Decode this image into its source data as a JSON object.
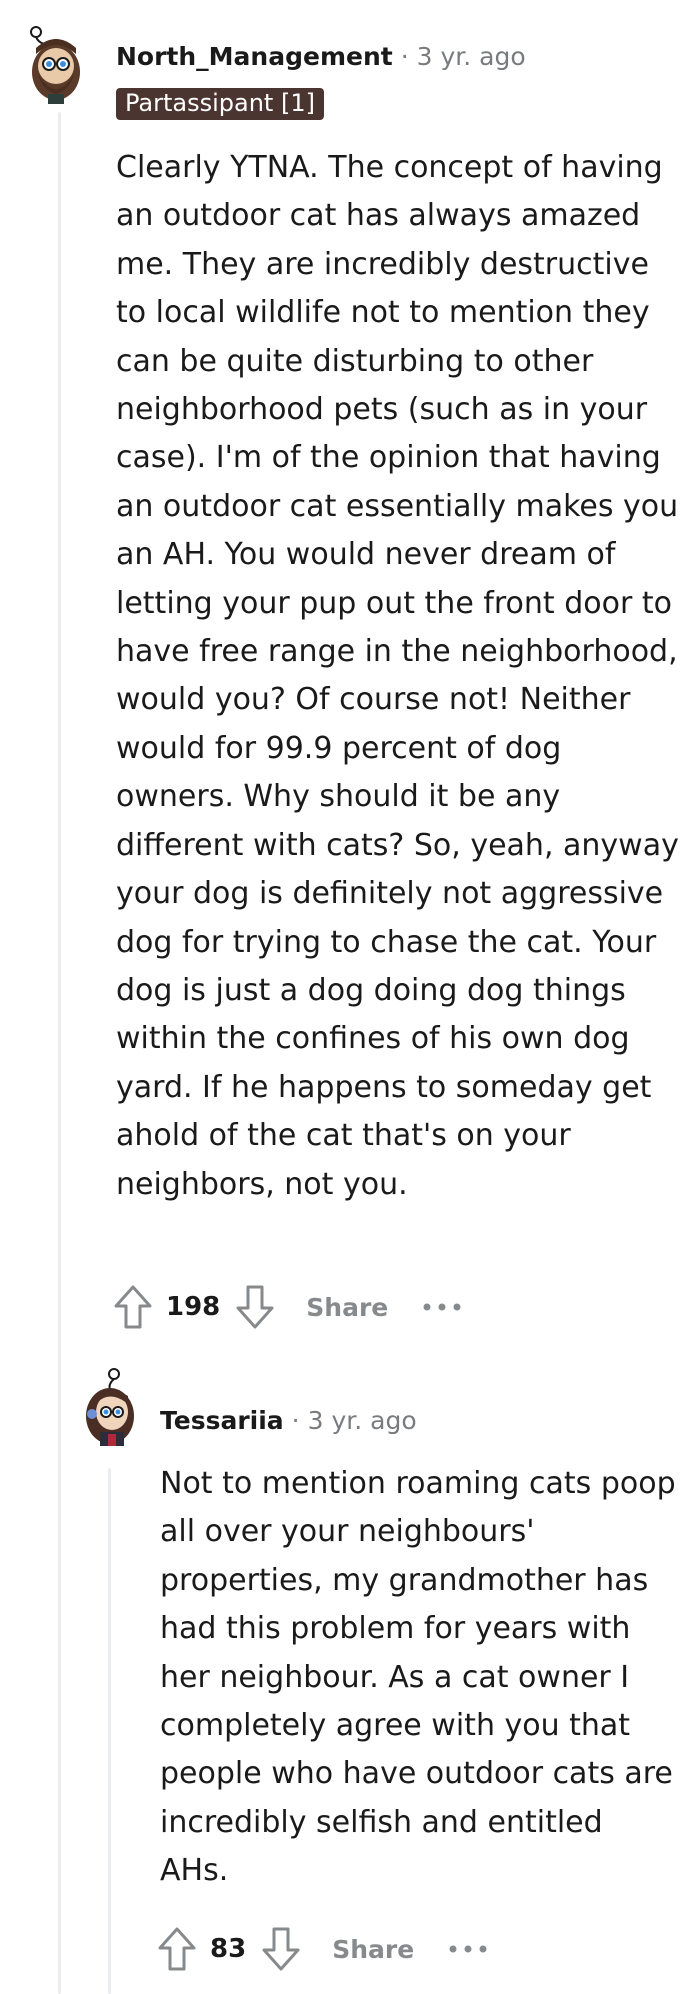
{
  "comments": [
    {
      "username": "North_Management",
      "separator": "·",
      "timestamp": "3 yr. ago",
      "flair": "Partassipant [1]",
      "avatar_icon": "bearded-man-avatar-icon",
      "body": "Clearly YTNA. The concept of having an outdoor cat has always amazed me. They are incredibly destructive to local wildlife not to mention they can be quite disturbing to other neighborhood pets (such as in your case). I'm of the opinion that having an outdoor cat essentially makes you an AH. You would never dream of letting your pup out the front door to have free range in the neighborhood, would you? Of course not! Neither would for 99.9 percent of dog owners. Why should it be any different with cats? So, yeah, anyway your dog is definitely not aggressive dog for trying to chase the cat. Your dog is just a dog doing dog things within the confines of his own dog yard. If he happens to someday get ahold of the cat that's on your neighbors, not you.",
      "score": "198",
      "share_label": "Share"
    },
    {
      "username": "Tessariia",
      "separator": "·",
      "timestamp": "3 yr. ago",
      "avatar_icon": "woman-avatar-icon",
      "body": "Not to mention roaming cats poop all over your neighbours' properties, my grandmother has had this problem for years with her neighbour. As a cat owner I completely agree with you that people who have outdoor cats are incredibly selfish and entitled AHs.",
      "score": "83",
      "share_label": "Share"
    }
  ],
  "icons": {
    "upvote": "upvote-arrow-icon",
    "downvote": "downvote-arrow-icon",
    "more": "more-options-icon"
  },
  "colors": {
    "flair_bg": "#4a3530",
    "muted_text": "#787c7e",
    "thread_line": "#e9edf0"
  }
}
